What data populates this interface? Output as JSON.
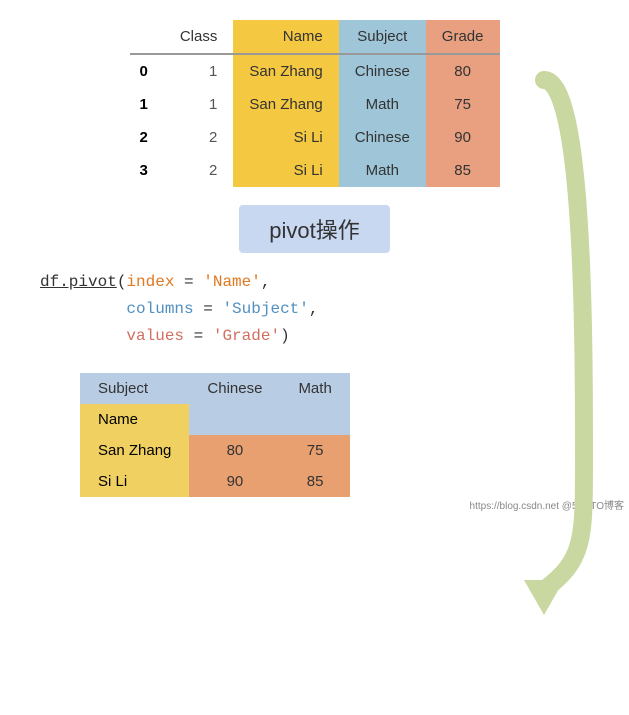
{
  "topTable": {
    "headers": [
      "Class",
      "Name",
      "Subject",
      "Grade"
    ],
    "rows": [
      {
        "idx": "0",
        "class": "1",
        "name": "San Zhang",
        "subject": "Chinese",
        "grade": "80"
      },
      {
        "idx": "1",
        "class": "1",
        "name": "San Zhang",
        "subject": "Math",
        "grade": "75"
      },
      {
        "idx": "2",
        "class": "2",
        "name": "Si Li",
        "subject": "Chinese",
        "grade": "90"
      },
      {
        "idx": "3",
        "class": "2",
        "name": "Si Li",
        "subject": "Math",
        "grade": "85"
      }
    ]
  },
  "pivotLabel": "pivot操作",
  "codeLines": {
    "line1_pre": "df.pivot(",
    "line1_param": "index",
    "line1_eq": " = ",
    "line1_val": "'Name'",
    "line1_comma": ",",
    "line2_indent": "        ",
    "line2_param": "columns",
    "line2_eq": " = ",
    "line2_val": "'Subject'",
    "line2_comma": ",",
    "line3_indent": "        ",
    "line3_param": "values",
    "line3_eq": " = ",
    "line3_val": "'Grade'",
    "line3_close": ")"
  },
  "bottomTable": {
    "subjectLabel": "Subject",
    "chineseLabel": "Chinese",
    "mathLabel": "Math",
    "nameLabel": "Name",
    "rows": [
      {
        "name": "San Zhang",
        "chinese": "80",
        "math": "75"
      },
      {
        "name": "Si Li",
        "chinese": "90",
        "math": "85"
      }
    ]
  },
  "watermark": "https://blog.csdn.net @51CTO博客"
}
